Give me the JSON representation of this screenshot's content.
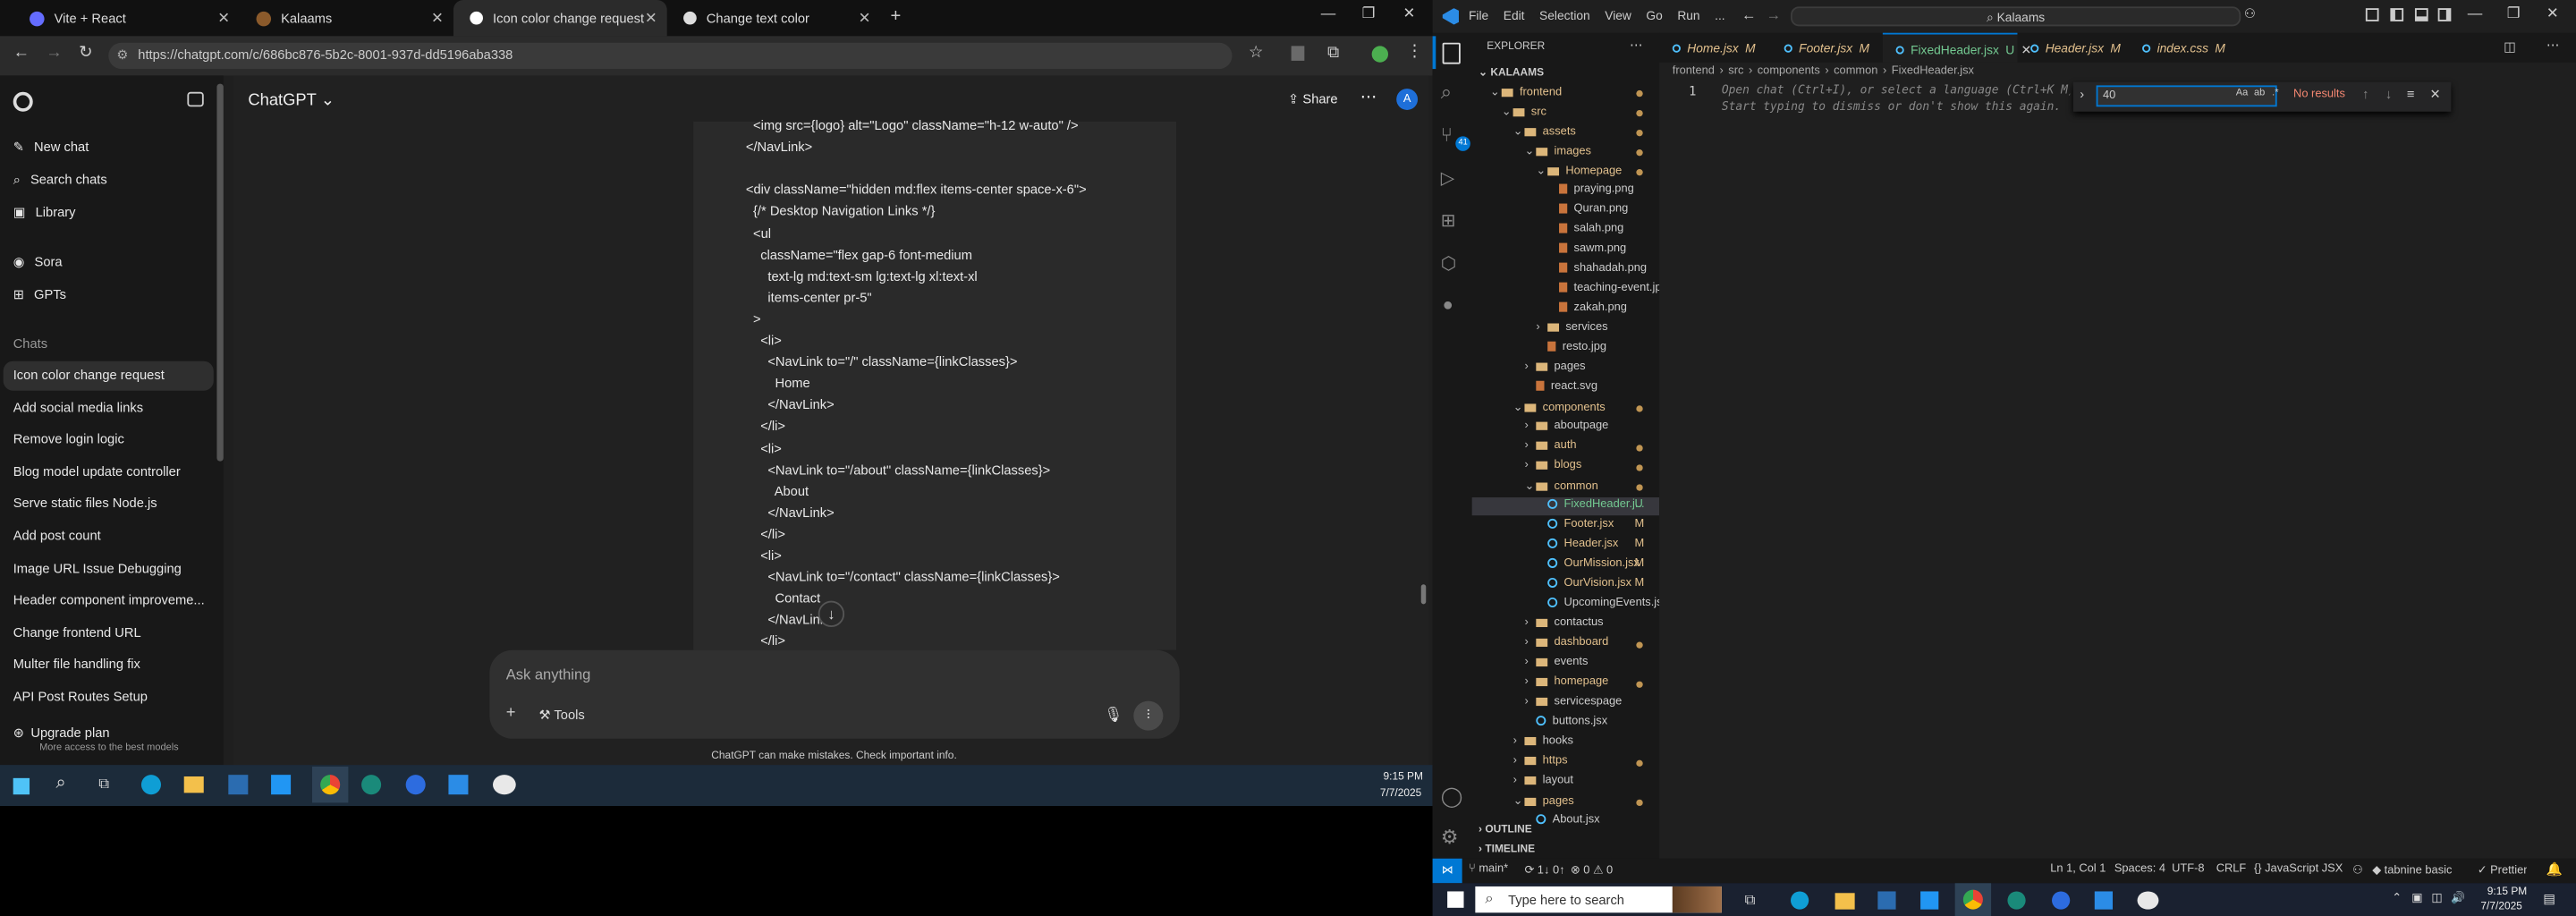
{
  "browser": {
    "tabs": [
      {
        "label": "Vite + React"
      },
      {
        "label": "Kalaams"
      },
      {
        "label": "Icon color change request",
        "active": true
      },
      {
        "label": "Change text color"
      }
    ],
    "url": "https://chatgpt.com/c/686bc876-5b2c-8001-937d-dd5196aba338"
  },
  "chatgpt": {
    "sidebar": {
      "new_chat": "New chat",
      "search": "Search chats",
      "library": "Library",
      "sora": "Sora",
      "gpts": "GPTs",
      "section": "Chats",
      "chats": [
        "Icon color change request",
        "Add social media links",
        "Remove login logic",
        "Blog model update controller",
        "Serve static files Node.js",
        "Add post count",
        "Image URL Issue Debugging",
        "Header component improveme...",
        "Change frontend URL",
        "Multer file handling fix",
        "API Post Routes Setup"
      ],
      "upgrade": "Upgrade plan",
      "upgrade_sub": "More access to the best models"
    },
    "header": {
      "title": "ChatGPT",
      "share": "Share",
      "avatar": "A"
    },
    "code_lines": [
      "  <img src={logo} alt=\"Logo\" className=\"h-12 w-auto\" />",
      "</NavLink>",
      "",
      "<div className=\"hidden md:flex items-center space-x-6\">",
      "  {/* Desktop Navigation Links */}",
      "  <ul",
      "    className=\"flex gap-6 font-medium",
      "      text-lg md:text-sm lg:text-lg xl:text-xl",
      "      items-center pr-5\"",
      "  >",
      "    <li>",
      "      <NavLink to=\"/\" className={linkClasses}>",
      "        Home",
      "      </NavLink>",
      "    </li>",
      "    <li>",
      "      <NavLink to=\"/about\" className={linkClasses}>",
      "        About",
      "      </NavLink>",
      "    </li>",
      "    <li>",
      "      <NavLink to=\"/contact\" className={linkClasses}>",
      "        Contact",
      "      </NavLink>",
      "    </li>"
    ],
    "composer": {
      "placeholder": "Ask anything",
      "tools": "Tools"
    },
    "disclaimer": "ChatGPT can make mistakes. Check important info."
  },
  "taskbar_left": {
    "time": "9:15 PM",
    "date": "7/7/2025"
  },
  "vscode": {
    "menu": [
      "File",
      "Edit",
      "Selection",
      "View",
      "Go",
      "Run",
      "..."
    ],
    "search": "Kalaams",
    "explorer_title": "EXPLORER",
    "root": "KALAAMS",
    "tree": [
      {
        "t": "frontend",
        "d": 1,
        "type": "folder",
        "open": true,
        "dot": true
      },
      {
        "t": "src",
        "d": 2,
        "type": "folder",
        "open": true,
        "dot": true
      },
      {
        "t": "assets",
        "d": 3,
        "type": "folder",
        "open": true,
        "dot": true
      },
      {
        "t": "images",
        "d": 4,
        "type": "folder",
        "open": true,
        "dot": true
      },
      {
        "t": "Homepage",
        "d": 5,
        "type": "folder",
        "open": true,
        "dot": true
      },
      {
        "t": "praying.png",
        "d": 6,
        "type": "img"
      },
      {
        "t": "Quran.png",
        "d": 6,
        "type": "img"
      },
      {
        "t": "salah.png",
        "d": 6,
        "type": "img"
      },
      {
        "t": "sawm.png",
        "d": 6,
        "type": "img"
      },
      {
        "t": "shahadah.png",
        "d": 6,
        "type": "img"
      },
      {
        "t": "teaching-event.jpg",
        "d": 6,
        "type": "img"
      },
      {
        "t": "zakah.png",
        "d": 6,
        "type": "img"
      },
      {
        "t": "services",
        "d": 5,
        "type": "folder",
        "open": false
      },
      {
        "t": "resto.jpg",
        "d": 5,
        "type": "img"
      },
      {
        "t": "pages",
        "d": 4,
        "type": "folder",
        "open": false
      },
      {
        "t": "react.svg",
        "d": 4,
        "type": "img"
      },
      {
        "t": "components",
        "d": 3,
        "type": "folder",
        "open": true,
        "dot": true
      },
      {
        "t": "aboutpage",
        "d": 4,
        "type": "folder",
        "open": false
      },
      {
        "t": "auth",
        "d": 4,
        "type": "folder",
        "open": false,
        "dot": true
      },
      {
        "t": "blogs",
        "d": 4,
        "type": "folder",
        "open": false,
        "dot": true
      },
      {
        "t": "common",
        "d": 4,
        "type": "folder",
        "open": true,
        "dot": true
      },
      {
        "t": "FixedHeader.j...",
        "d": 5,
        "type": "jsx",
        "badge": "U",
        "sel": true
      },
      {
        "t": "Footer.jsx",
        "d": 5,
        "type": "jsx",
        "badge": "M"
      },
      {
        "t": "Header.jsx",
        "d": 5,
        "type": "jsx",
        "badge": "M"
      },
      {
        "t": "OurMission.jsx",
        "d": 5,
        "type": "jsx",
        "badge": "M"
      },
      {
        "t": "OurVision.jsx",
        "d": 5,
        "type": "jsx",
        "badge": "M"
      },
      {
        "t": "UpcomingEvents.jsx",
        "d": 5,
        "type": "jsx"
      },
      {
        "t": "contactus",
        "d": 4,
        "type": "folder",
        "open": false
      },
      {
        "t": "dashboard",
        "d": 4,
        "type": "folder",
        "open": false,
        "dot": true
      },
      {
        "t": "events",
        "d": 4,
        "type": "folder",
        "open": false
      },
      {
        "t": "homepage",
        "d": 4,
        "type": "folder",
        "open": false,
        "dot": true
      },
      {
        "t": "servicespage",
        "d": 4,
        "type": "folder",
        "open": false
      },
      {
        "t": "buttons.jsx",
        "d": 4,
        "type": "jsx"
      },
      {
        "t": "hooks",
        "d": 3,
        "type": "folder",
        "open": false
      },
      {
        "t": "https",
        "d": 3,
        "type": "folder",
        "open": false,
        "dot": true
      },
      {
        "t": "layout",
        "d": 3,
        "type": "folder",
        "open": false
      },
      {
        "t": "pages",
        "d": 3,
        "type": "folder",
        "open": true,
        "dot": true
      },
      {
        "t": "About.jsx",
        "d": 4,
        "type": "jsx"
      }
    ],
    "outline": "OUTLINE",
    "timeline": "TIMELINE",
    "editor_tabs": [
      {
        "label": "Home.jsx",
        "badge": "M"
      },
      {
        "label": "Footer.jsx",
        "badge": "M"
      },
      {
        "label": "FixedHeader.jsx",
        "badge": "U",
        "active": true
      },
      {
        "label": "Header.jsx",
        "badge": "M"
      },
      {
        "label": "index.css",
        "badge": "M"
      }
    ],
    "breadcrumb": [
      "frontend",
      "src",
      "components",
      "common",
      "FixedHeader.jsx"
    ],
    "line_number": "1",
    "hint1": "Open chat (Ctrl+I), or select a language (Ctrl+K M), or fill with template to get started.",
    "hint2": "Start typing to dismiss or don't show this again.",
    "find": {
      "value": "40",
      "result": "No results"
    },
    "status": {
      "branch": "main*",
      "sync": "1↓ 0↑",
      "problems": "⊗ 0 ⚠ 0",
      "position": "Ln 1, Col 1",
      "spaces": "Spaces: 4",
      "encoding": "UTF-8",
      "eol": "CRLF",
      "language": "JavaScript JSX",
      "tabnine": "tabnine basic",
      "prettier": "Prettier"
    }
  },
  "windows_taskbar": {
    "search": "Type here to search",
    "time": "9:15 PM",
    "date": "7/7/2025"
  }
}
